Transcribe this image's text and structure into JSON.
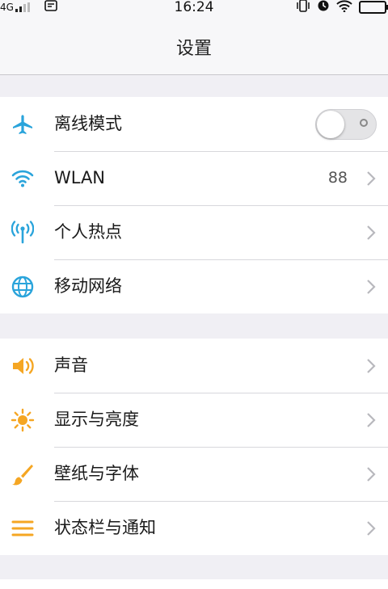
{
  "status_bar": {
    "network_type": "4G",
    "time": "16:24"
  },
  "nav": {
    "title": "设置"
  },
  "colors": {
    "accent_blue": "#2aa4db",
    "accent_orange": "#f5a623",
    "chevron": "#b8b8bd"
  },
  "sections": [
    {
      "items": [
        {
          "label": "离线模式",
          "icon": "airplane-icon",
          "control": "toggle",
          "toggle_on": false
        },
        {
          "label": "WLAN",
          "icon": "wifi-icon",
          "value": "88"
        },
        {
          "label": "个人热点",
          "icon": "hotspot-icon"
        },
        {
          "label": "移动网络",
          "icon": "globe-icon"
        }
      ]
    },
    {
      "items": [
        {
          "label": "声音",
          "icon": "speaker-icon"
        },
        {
          "label": "显示与亮度",
          "icon": "brightness-icon"
        },
        {
          "label": "壁纸与字体",
          "icon": "brush-icon"
        },
        {
          "label": "状态栏与通知",
          "icon": "menu-lines-icon"
        }
      ]
    }
  ]
}
